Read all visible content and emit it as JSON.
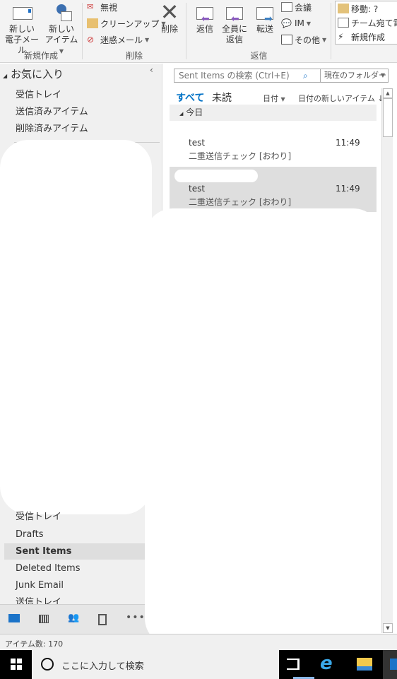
{
  "ribbon": {
    "new_group": {
      "label": "新規作成",
      "new_email": "新しい\n電子メール",
      "new_email_l1": "新しい",
      "new_email_l2": "電子メール",
      "new_items_l1": "新しい",
      "new_items_l2": "アイテム"
    },
    "delete_group": {
      "label": "削除",
      "ignore": "無視",
      "cleanup": "クリーンアップ",
      "junk": "迷惑メール",
      "delete": "削除"
    },
    "respond_group": {
      "label": "返信",
      "reply": "返信",
      "reply_all_l1": "全員に",
      "reply_all_l2": "返信",
      "forward": "転送",
      "meeting": "会議",
      "im": "IM",
      "more": "その他"
    },
    "quick_steps": {
      "move": "移動: ?",
      "team": "チーム宛て電子",
      "new": "新規作成"
    }
  },
  "left": {
    "favorites_title": "お気に入り",
    "favorites": [
      "受信トレイ",
      "送信済みアイテム",
      "削除済みアイテム"
    ],
    "folders": [
      "受信トレイ",
      "Drafts",
      "Sent Items",
      "Deleted Items",
      "Junk Email",
      "送信トレイ"
    ],
    "selected_folder": "Sent Items"
  },
  "search": {
    "placeholder": "Sent Items の検索 (Ctrl+E)",
    "scope": "現在のフォルダー"
  },
  "filters": {
    "all": "すべて",
    "unread": "未読",
    "sort_by": "日付",
    "order": "日付の新しいアイテム"
  },
  "group_header": "今日",
  "messages": [
    {
      "subject": "test",
      "preview": "二重送信チェック [おわり]",
      "time": "11:49",
      "selected": false
    },
    {
      "subject": "test",
      "preview": "二重送信チェック [おわり]",
      "time": "11:49",
      "selected": true
    }
  ],
  "status": {
    "item_count": "アイテム数: 170"
  },
  "taskbar": {
    "search_placeholder": "ここに入力して検索"
  },
  "colors": {
    "accent": "#0072c6",
    "reply_arrow": "#8a5bbf",
    "forward_arrow": "#3c7fc1",
    "selected_bg": "#dedede"
  }
}
